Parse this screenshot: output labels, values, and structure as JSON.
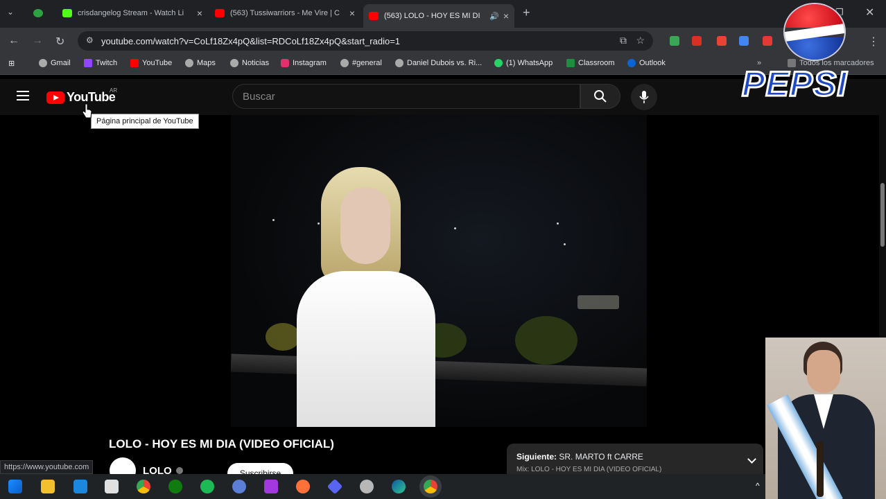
{
  "browser": {
    "tabs": [
      {
        "label": "",
        "icon": "xbox-icon",
        "color": "#2ca243"
      },
      {
        "label": "crisdangelog Stream - Watch Li",
        "icon": "kick-icon",
        "color": "#53fc18"
      },
      {
        "label": "(563) Tussiwarriors - Me Vire | C",
        "icon": "youtube-icon",
        "color": "#ff0000"
      },
      {
        "label": "(563) LOLO - HOY ES MI DI",
        "icon": "youtube-icon",
        "color": "#ff0000"
      }
    ],
    "address": "youtube.com/watch?v=CoLf18Zx4pQ&list=RDCoLf18Zx4pQ&start_radio=1",
    "bookmarks": [
      {
        "label": "Gmail",
        "color": "#aaa"
      },
      {
        "label": "Twitch",
        "color": "#9146ff"
      },
      {
        "label": "YouTube",
        "color": "#ff0000"
      },
      {
        "label": "Maps",
        "color": "#aaa"
      },
      {
        "label": "Noticias",
        "color": "#aaa"
      },
      {
        "label": "Instagram",
        "color": "#e1306c"
      },
      {
        "label": "#general",
        "color": "#aaa"
      },
      {
        "label": "Daniel Dubois vs. Ri...",
        "color": "#aaa"
      },
      {
        "label": "(1) WhatsApp",
        "color": "#25d366"
      },
      {
        "label": "Classroom",
        "color": "#1e8e3e"
      },
      {
        "label": "Outlook",
        "color": "#0a64d8"
      }
    ],
    "bookmarks_all": "Todos los marcadores",
    "status_url": "https://www.youtube.com"
  },
  "youtube": {
    "logo_text": "YouTube",
    "country_code": "AR",
    "search_placeholder": "Buscar",
    "tooltip": "Página principal de YouTube",
    "video_title": "LOLO - HOY ES MI DIA (VIDEO OFICIAL)",
    "channel_name": "LOLO",
    "subscribe_label": "Suscribirse",
    "up_next_prefix": "Siguiente:",
    "up_next_title": "SR. MARTO ft CARRE",
    "up_next_sub": "Mix: LOLO - HOY ES MI DIA (VIDEO OFICIAL)"
  },
  "overlay": {
    "pepsi_text": "PEPSI"
  }
}
